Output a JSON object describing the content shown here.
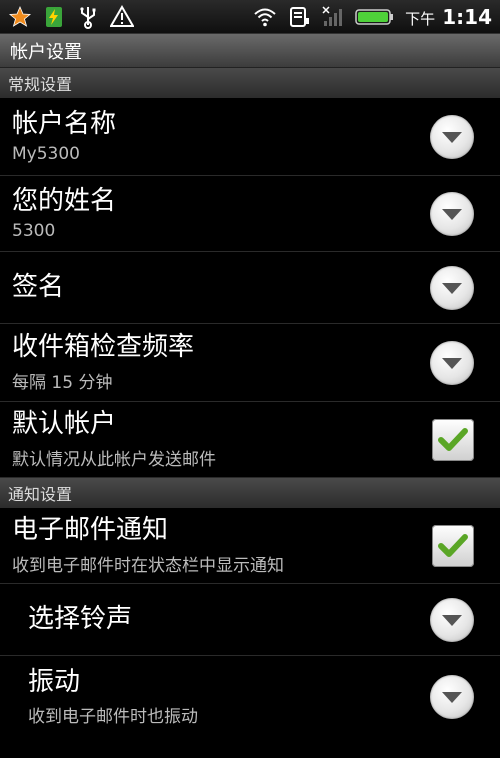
{
  "status_bar": {
    "icons_left": [
      "star-icon",
      "battery-charging-icon",
      "usb-icon",
      "warning-icon"
    ],
    "icons_right": [
      "wifi-icon",
      "sim-icon",
      "signal-icon",
      "battery-icon"
    ],
    "ampm": "下午",
    "time": "1:14"
  },
  "page_title": "帐户设置",
  "sections": {
    "general": "常规设置",
    "notifications": "通知设置"
  },
  "items": {
    "account_name": {
      "title": "帐户名称",
      "subtitle": "My5300"
    },
    "your_name": {
      "title": "您的姓名",
      "subtitle": "5300"
    },
    "signature": {
      "title": "签名"
    },
    "inbox_check": {
      "title": "收件箱检查频率",
      "subtitle": "每隔 15 分钟"
    },
    "default_account": {
      "title": "默认帐户",
      "subtitle": "默认情况从此帐户发送邮件",
      "checked": true
    },
    "email_notify": {
      "title": "电子邮件通知",
      "subtitle": "收到电子邮件时在状态栏中显示通知",
      "checked": true
    },
    "ringtone": {
      "title": "选择铃声"
    },
    "vibrate": {
      "title": "振动",
      "subtitle": "收到电子邮件时也振动"
    }
  },
  "colors": {
    "check_green": "#5aa626",
    "star_orange": "#f08c1e",
    "battery_green": "#4fd13a"
  }
}
